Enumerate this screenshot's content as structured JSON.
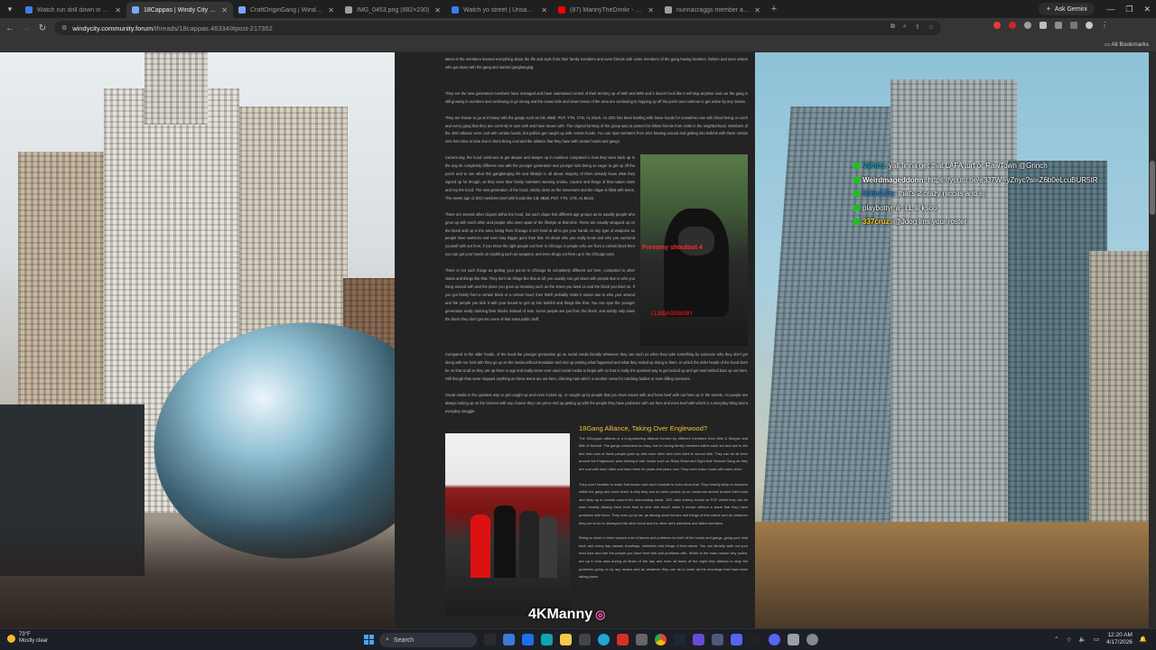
{
  "browser": {
    "tabs": [
      {
        "title": "Watch run drill down in some chi",
        "active": false,
        "color": "#3b7de9"
      },
      {
        "title": "18Cappas | Windy City Roleplay",
        "active": true,
        "color": "#7aa7ff"
      },
      {
        "title": "CraftOriginGang | Windy City Ro",
        "active": false,
        "color": "#7aa7ff"
      },
      {
        "title": "IMG_0453.png (882×230)",
        "active": false,
        "color": "#9e9e9e"
      },
      {
        "title": "Watch yo street | Unsanctioned",
        "active": false,
        "color": "#3b7de9"
      },
      {
        "title": "(87) MannyTheDrinkr - YouTube",
        "active": false,
        "color": "#ff0000"
      },
      {
        "title": "nunnacraggs member app",
        "active": false,
        "color": "#9e9e9e"
      }
    ],
    "ask_gemini": "Ask Gemini",
    "url_host": "windycity.community.forum",
    "url_path": "/threads/18cappas.46334/#post-217352",
    "all_bookmarks": "All Bookmarks"
  },
  "chat": [
    {
      "user": "Vjkhdu:",
      "msg": "yall finna get that LAFA turf or RawTown @Grinch",
      "cls": "u1"
    },
    {
      "user": "Weirdmageddonn:",
      "msg": "https://youtu.be/e3J7W--yZnyc?si=Z6b0eLcuBUR5tR",
      "cls": "u2"
    },
    {
      "user": "556n223s:",
      "msg": "that's 2 crazy niccas and sj",
      "cls": "u3"
    },
    {
      "user": "playboitymlr:",
      "msg": "LL lil ksoo",
      "cls": "u4"
    },
    {
      "user": "337cruz:",
      "msg": "@Jdog lms your roster",
      "cls": "u5"
    }
  ],
  "article": {
    "p1": "latest of the members learned everything about the life and style from their family members and even friends with some members of the gang having brothers, fathers and even sisters who got down with the gang and started gangbanging.",
    "p2": "They are the new generation members have managed and have maintained control of their territory up of 56th and 60th and it doesn't look like it will stop anytime soon as the gang is still growing in numbers and continuing to go strong and the newer kids and newer teens of the area are continuing to hopping up off the porch and continue to get active by any means.",
    "p3": "They are known to go at it heavy with the gangs such as CB, 8Ball, PGF, YTN, CTB, AL Block. As JDG has been beefing with these hoods for sometime now with blood being on each and every gang that they are currently in tune with and have issues with. The original forming of the group was to protect his fellow friends from rivals in the neighborhood. Members of the JDG alliance were cool with certain hoods, but politics get caught up with certain hoods. You can spot members from JDG beating around and getting into bullshit with these certain sets from time to time due to them being cool and the alliance that they have with certain hoods and gangs.",
    "p4": "Current day, the hood continues to get deeper and deeper up in numbers compared to how they were back up in the day its completely different now with the younger generation and younger kids being so eager to get up off the porch and to see what this gangbanging life and lifestyle is all about. Majority of them already know what they signed up for though, as they seen their family members wearing undies, cousins and things of that nature claim and rep the hood. The new generation of the hood, strictly claim as the movement and the clique is filled with teens. The newer age of JDG members beef with hoods like CB, 8Ball, PGF, YTN, CTB, AL Block.",
    "p5": "There are several other cliques within the hood, but each clique has different age groups as its usually people who grew up with each other and people who were apart of the lifestyle at that time. Teens are usually strapped up on the block and up in the area, being from Chicago it isn't hard at all to get your hands on any type of weapons as people have switches and even way bigger guns than that. Its about who you really know and who you surround yourself with out here, if you know the right people out here in Chicago or people who are from a certain block then you can get your hands on anything such as weapons, and even drugs out here up in the Chicago area.",
    "p6": "There is not such things as getting your put-on in Chicago its completely different out here, compared to other states and things like that. They don't do things like that at all, you usually can get down with people due to who you hang around with and the place you grew up meaning such as the street you lived on and the block you lived on. If you got family from a certain block or a certain hood, then that'll probably make it easier due to who your around and the people you kick it with your bound to get up into bullshit and things like that. You can spot the younger generation really claiming their blocks instead of sets. Some people are just from the block, and strictly only claim the block they don't get into none of that extra politic stuff.",
    "p7": "Compared to the older heads, of the hood the younger generation go on social media literally whenever they can such as when they take something by someone who they don't get along with nor fuck with they go up on the media without hesitation and end up posting what happened and what they ended up doing to them. In which the older heads of the hood don't be on that at all as they are up there in age and really never ever used social media to begin with so that is really the quickest way to get locked up and get sent behind bars up out here. Still though that never stopped anything as these teens are out here, claiming hats which is another name for catching bodies or even killing someone.",
    "p8": "Social media is the quickest way to get caught up and even locked up, or caught up by people that you have issues with and have beef with out here up in the streets. As people are always lurking up on the internet with any chance they can get to end up getting up with the people they have problems with out here and even beef with which is a everyday thing and a everyday struggle.",
    "float_caption_1": "Fresomy shoutout 4",
    "float_caption_2": "LLBBAGDBABY",
    "section_title": "18Gang Alliance, Taking Over Englewood?",
    "s1": "The 18Cappas alliance is a long-standing alliance formed by different members from 56th & Morgan and 66th & Normal. The gangs connected so easy, due to having family members within each set and due to the fact that most of these people grew up with each other and even went to school with. They can be all seen around the Englewood area kicking it with hoods such as Risky Road and Eight Ball Stewart Gang as they are cool with each other and have been for years and years now. They even make music with each other.",
    "s2": "They won't hesitate to make that known and won't hesitate to even show that. They heavily deep in numbers within the gang and hood which is why they can be seen posted up on numerous streets around their hood and deep up in crowds around the surrounding areas. JDG main enemy known as PGF which they can be seen heavily dissing them from time to time and they'll make it known without a issue that they have problems with them. They even go as far, as dissing dead homies and things of that nature and do whatever they can to do to disrespect the other hood and the other set's members and fallen members.",
    "s3": "Being so close to them causes a lot of issues and problems for both of the hoods and gangs, going your rival each and every day causes shootings, robberies and things of that nature. You can literally walk out your front door and see the people you have beef with and problems with. Which is the main reason why police, are up in that area during all times of the day and even all times of the night they attempt to stop the problems going on by any means and do whatever they can do to lower all the shootings that have been taking place."
  },
  "watermark": "4KManny",
  "taskbar": {
    "temp": "73°F",
    "condition": "Mostly clear",
    "search": "Search",
    "time": "12:20 AM",
    "date": "4/17/2026"
  }
}
